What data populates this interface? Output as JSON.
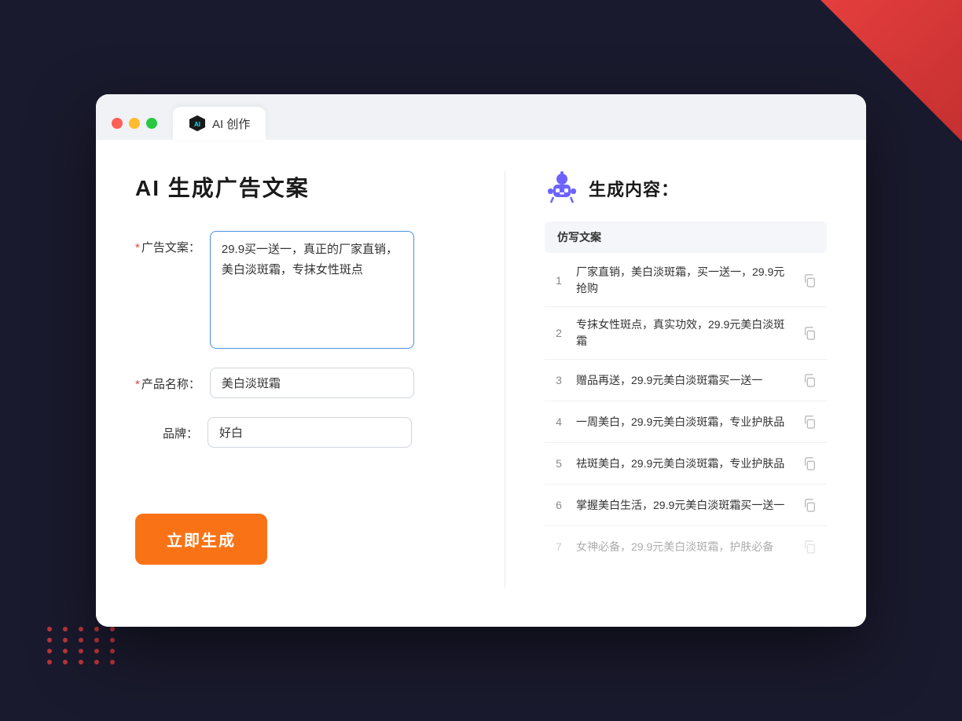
{
  "background": {
    "color": "#1a1a2e"
  },
  "tab": {
    "label": "AI 创作",
    "icon": "ai-icon"
  },
  "page_title": "AI 生成广告文案",
  "form": {
    "ad_copy_label": "广告文案：",
    "ad_copy_required": "*",
    "ad_copy_value": "29.9买一送一，真正的厂家直销，美白淡斑霜，专抹女性斑点",
    "product_name_label": "产品名称：",
    "product_name_required": "*",
    "product_name_value": "美白淡斑霜",
    "brand_label": "品牌：",
    "brand_value": "好白",
    "generate_btn": "立即生成"
  },
  "result": {
    "header": "生成内容：",
    "column_header": "仿写文案",
    "items": [
      {
        "num": "1",
        "text": "厂家直销，美白淡斑霜，买一送一，29.9元抢购"
      },
      {
        "num": "2",
        "text": "专抹女性斑点，真实功效，29.9元美白淡斑霜"
      },
      {
        "num": "3",
        "text": "赠品再送，29.9元美白淡斑霜买一送一"
      },
      {
        "num": "4",
        "text": "一周美白，29.9元美白淡斑霜，专业护肤品"
      },
      {
        "num": "5",
        "text": "祛斑美白，29.9元美白淡斑霜，专业护肤品"
      },
      {
        "num": "6",
        "text": "掌握美白生活，29.9元美白淡斑霜买一送一"
      },
      {
        "num": "7",
        "text": "女神必备，29.9元美白淡斑霜，护肤必备",
        "faded": true
      }
    ]
  }
}
